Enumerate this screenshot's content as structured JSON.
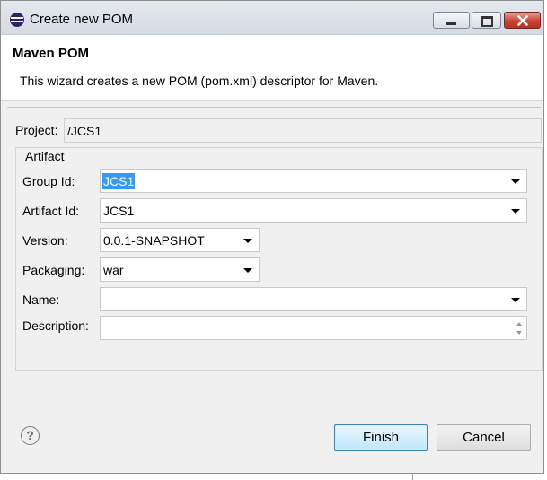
{
  "window": {
    "title": "Create new POM",
    "icon": "eclipse-icon",
    "controls": [
      "minimize-icon",
      "maximize-icon",
      "close-icon"
    ]
  },
  "header": {
    "title": "Maven POM",
    "description": "This wizard creates a new POM (pom.xml) descriptor for Maven."
  },
  "project": {
    "label": "Project:",
    "value": "/JCS1"
  },
  "artifact_group": {
    "label": "Artifact",
    "group_id": {
      "label": "Group Id:",
      "value": "JCS1"
    },
    "artifact_id": {
      "label": "Artifact Id:",
      "value": "JCS1"
    },
    "version": {
      "label": "Version:",
      "value": "0.0.1-SNAPSHOT"
    },
    "packaging": {
      "label": "Packaging:",
      "value": "war"
    },
    "name": {
      "label": "Name:",
      "value": ""
    },
    "description": {
      "label": "Description:",
      "value": ""
    }
  },
  "buttons": {
    "help_icon": "question-mark-icon",
    "help_glyph": "?",
    "finish": "Finish",
    "cancel": "Cancel"
  },
  "colors": {
    "selection": "#3399ff",
    "default_button_border": "#3c7fb1",
    "close_button": "#c94532"
  }
}
